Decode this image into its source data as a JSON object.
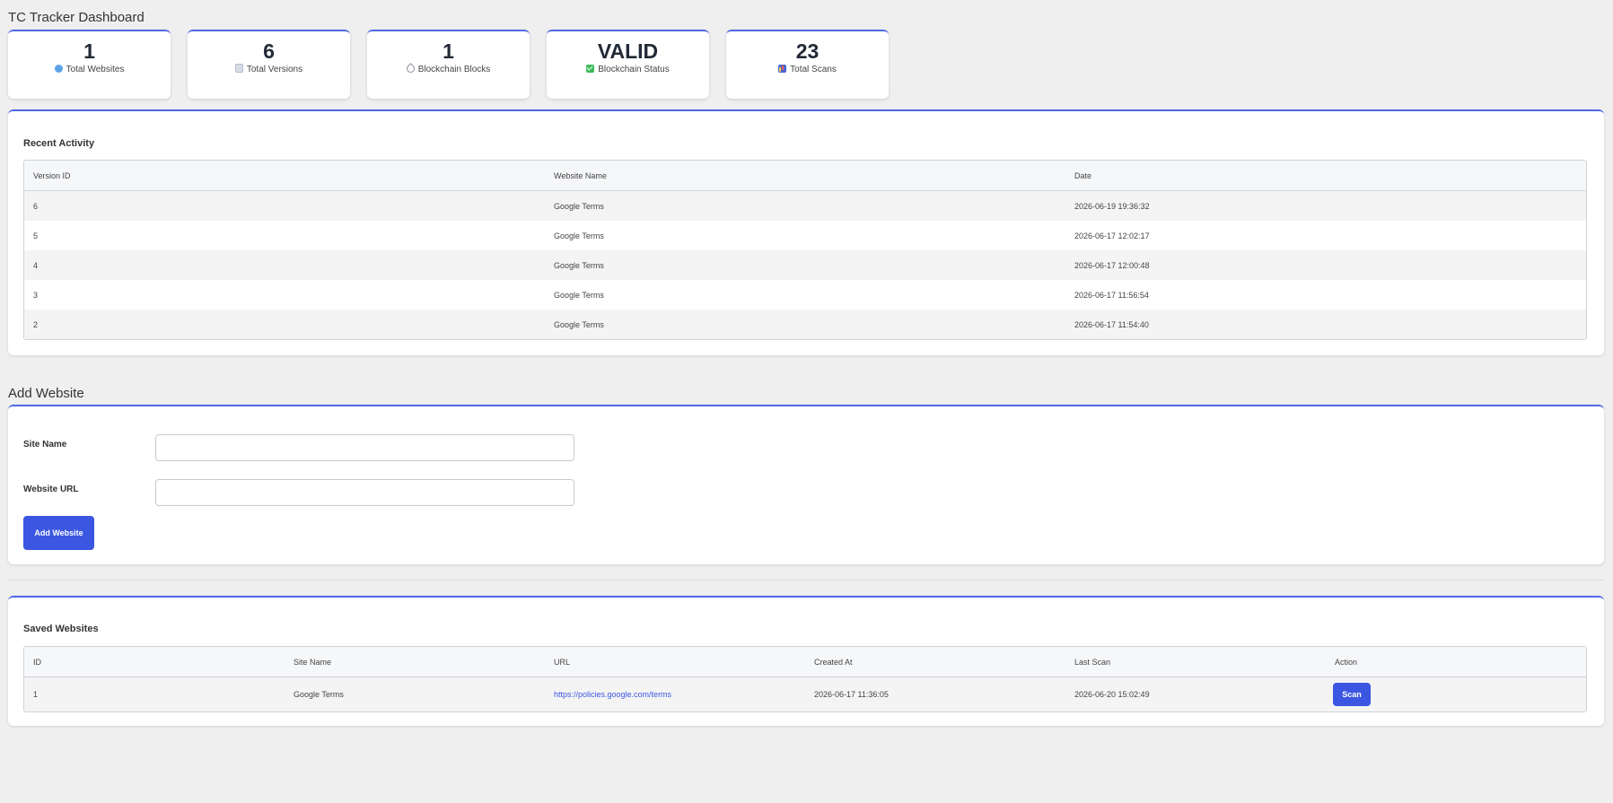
{
  "app": {
    "title": "TC Tracker Dashboard"
  },
  "stats": [
    {
      "value": "1",
      "label": "Total Websites",
      "icon": "globe-icon"
    },
    {
      "value": "6",
      "label": "Total Versions",
      "icon": "document-icon"
    },
    {
      "value": "1",
      "label": "Blockchain Blocks",
      "icon": "link-icon"
    },
    {
      "value": "VALID",
      "label": "Blockchain Status",
      "icon": "checkmark-icon"
    },
    {
      "value": "23",
      "label": "Total Scans",
      "icon": "bar-chart-icon"
    }
  ],
  "recent_activity": {
    "heading": "Recent Activity",
    "columns": [
      "Version ID",
      "Website Name",
      "Date"
    ],
    "rows": [
      [
        "6",
        "Google Terms",
        "2026-06-19 19:36:32"
      ],
      [
        "5",
        "Google Terms",
        "2026-06-17 12:02:17"
      ],
      [
        "4",
        "Google Terms",
        "2026-06-17 12:00:48"
      ],
      [
        "3",
        "Google Terms",
        "2026-06-17 11:56:54"
      ],
      [
        "2",
        "Google Terms",
        "2026-06-17 11:54:40"
      ]
    ]
  },
  "add_website": {
    "title": "Add Website",
    "site_name_label": "Site Name",
    "site_name_value": "",
    "url_label": "Website URL",
    "url_value": "",
    "submit_label": "Add Website"
  },
  "saved_websites": {
    "heading": "Saved Websites",
    "columns": [
      "ID",
      "Site Name",
      "URL",
      "Created At",
      "Last Scan",
      "Action"
    ],
    "rows": [
      {
        "id": "1",
        "site_name": "Google Terms",
        "url": "https://policies.google.com/terms",
        "created_at": "2026-06-17 11:36:05",
        "last_scan": "2026-06-20 15:02:49",
        "action_label": "Scan"
      }
    ]
  },
  "colors": {
    "accent": "#3b56e0",
    "card_border_top": "#4e6ae6",
    "page_background": "#efefef"
  }
}
